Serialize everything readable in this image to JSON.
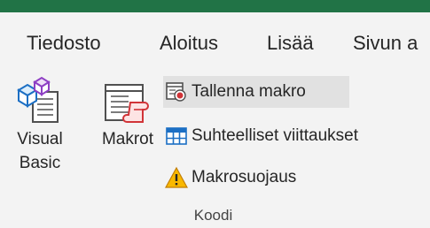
{
  "window": {
    "accent_color": "#217346"
  },
  "ribbon": {
    "tabs": [
      {
        "label": "Tiedosto"
      },
      {
        "label": "Aloitus"
      },
      {
        "label": "Lisää"
      },
      {
        "label": "Sivun a"
      }
    ]
  },
  "code_group": {
    "label": "Koodi",
    "visual_basic": {
      "label_line1": "Visual",
      "label_line2": "Basic",
      "icon": "visual-basic-icon"
    },
    "macros": {
      "label": "Makrot",
      "icon": "macros-icon"
    },
    "record_macro": {
      "label": "Tallenna makro",
      "icon": "record-macro-icon"
    },
    "relative_refs": {
      "label": "Suhteelliset viittaukset",
      "icon": "relative-references-icon"
    },
    "macro_security": {
      "label": "Makrosuojaus",
      "icon": "warning-icon"
    }
  }
}
